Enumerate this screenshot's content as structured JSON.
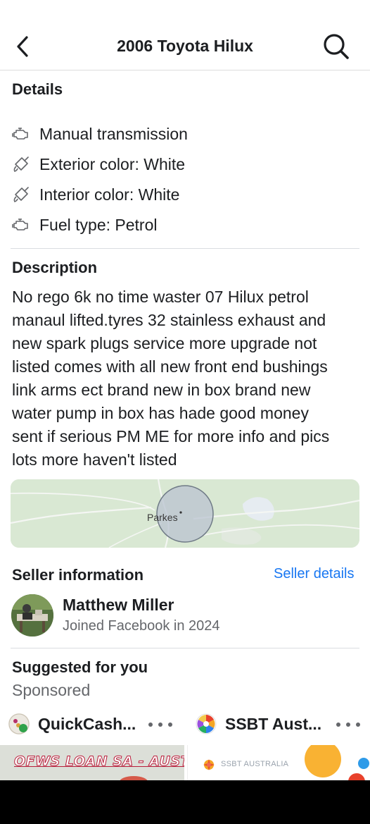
{
  "header": {
    "title": "2006 Toyota Hilux"
  },
  "icons": {
    "back": "chevron-left-icon",
    "search": "search-icon",
    "engine": "engine-icon",
    "paint": "paint-brush-icon",
    "more": "more-horizontal-icon"
  },
  "details": {
    "heading": "Details",
    "items": [
      {
        "icon": "engine-icon",
        "label": "Manual transmission"
      },
      {
        "icon": "paint-brush-icon",
        "label": "Exterior color: White"
      },
      {
        "icon": "paint-brush-icon",
        "label": "Interior color: White"
      },
      {
        "icon": "engine-icon",
        "label": "Fuel type: Petrol"
      }
    ]
  },
  "description": {
    "heading": "Description",
    "lines": [
      "No rego 6k no time waster 07 Hilux petrol",
      "manaul lifted.tyres 32 stainless exhaust and",
      "new spark plugs service more upgrade not",
      "listed comes with all new front end bushings",
      "link arms ect brand new in box brand new",
      "water pump in box has hade good money",
      "sent if serious PM ME for more info and pics",
      "lots more haven't listed"
    ]
  },
  "map": {
    "location_label": "Parkes"
  },
  "seller": {
    "heading": "Seller information",
    "details_link": "Seller details",
    "name": "Matthew Miller",
    "joined": "Joined Facebook in 2024"
  },
  "suggested": {
    "heading": "Suggested for you",
    "sponsored_label": "Sponsored",
    "ads": [
      {
        "name": "QuickCash...",
        "banner_text": "OFWS LOAN SA - AUSTRALIA"
      },
      {
        "name": "SSBT Aust...",
        "banner_text": "SSBT AUSTRALIA"
      }
    ]
  },
  "colors": {
    "link": "#1877f2",
    "secondary_text": "#65676b",
    "divider": "#dadde1"
  }
}
